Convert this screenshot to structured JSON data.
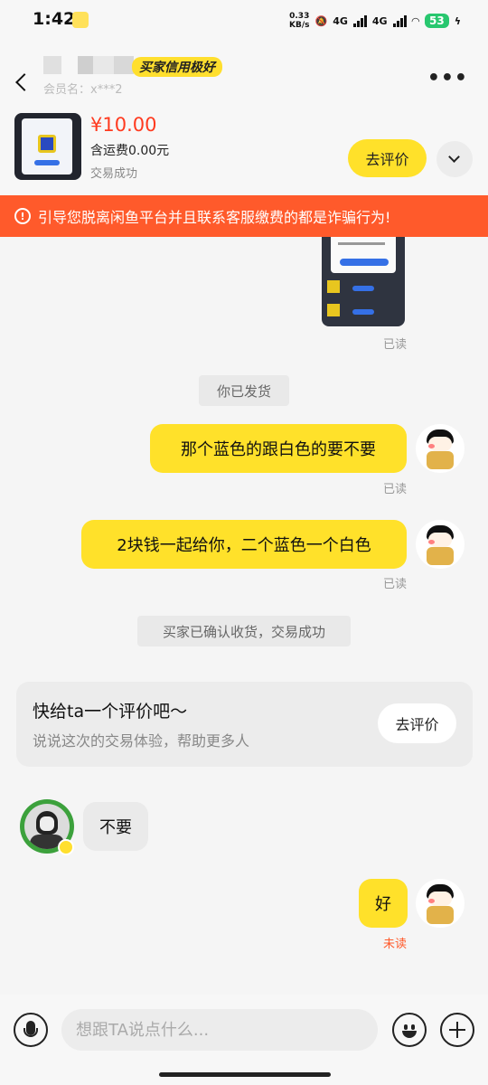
{
  "status_bar": {
    "time": "1:42",
    "net_speed_value": "0.33",
    "net_speed_unit": "KB/s",
    "network_1": "4G",
    "network_2": "4G",
    "battery": "53"
  },
  "header": {
    "seller_badge": "买家信用极好",
    "member_name": "会员名：x***2",
    "more_icon": "more-horizontal-icon"
  },
  "product": {
    "price": "¥10.00",
    "shipping": "含运费0.00元",
    "status": "交易成功",
    "review_button": "去评价"
  },
  "warning": {
    "text": "引导您脱离闲鱼平台并且联系客服缴费的都是诈骗行为!",
    "color": "#ff5a2b"
  },
  "messages": {
    "image_read": "已读",
    "system_shipped": "你已发货",
    "msg1": "那个蓝色的跟白色的要不要",
    "msg1_status": "已读",
    "msg2": "2块钱一起给你，二个蓝色一个白色",
    "msg2_status": "已读",
    "system_confirmed": "买家已确认收货，交易成功",
    "seller_msg": "不要",
    "msg3": "好",
    "msg3_status": "未读"
  },
  "review_card": {
    "title": "快给ta一个评价吧～",
    "subtitle": "说说这次的交易体验，帮助更多人",
    "button": "去评价"
  },
  "input_bar": {
    "placeholder": "想跟TA说点什么..."
  },
  "colors": {
    "accent": "#ffe12a",
    "price": "#ff3a1f"
  }
}
